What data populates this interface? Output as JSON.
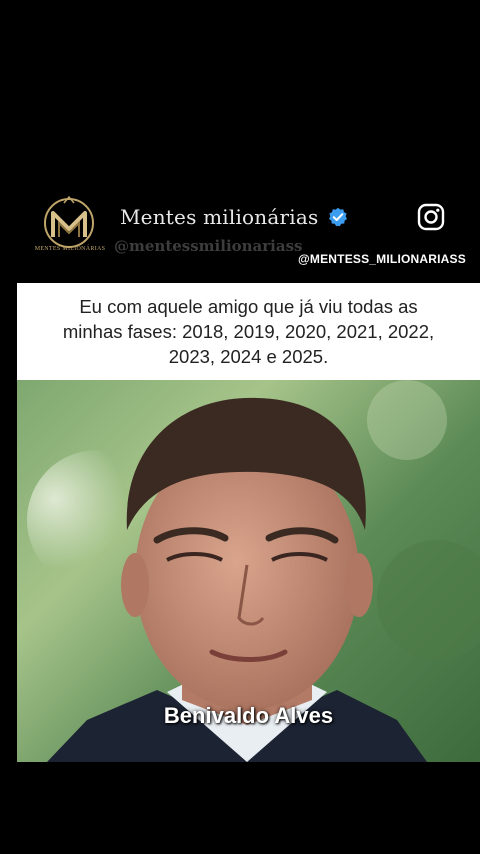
{
  "account": {
    "name": "Mentes milionárias",
    "handle": "@mentessmilionariass",
    "logo_text": "MENTES MILIONÁRIAS",
    "instagram_handle": "@MENTESS_MILIONARIASS"
  },
  "caption": {
    "text": "Eu com aquele amigo que já viu todas as minhas fases: 2018, 2019, 2020, 2021, 2022, 2023, 2024 e 2025."
  },
  "photo": {
    "overlay_name": "Benivaldo Alves"
  },
  "colors": {
    "background": "#000000",
    "verified_blue": "#3b9cf0",
    "logo_gold": "#bfa56a"
  }
}
